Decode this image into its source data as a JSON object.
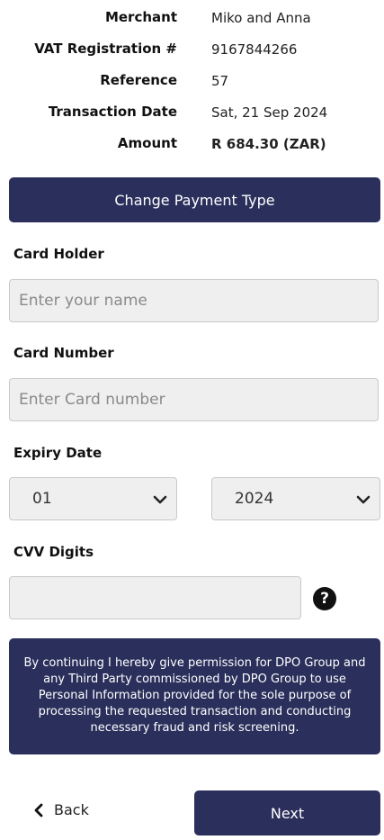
{
  "summary": {
    "merchant_label": "Merchant",
    "merchant_value": "Miko and Anna",
    "vat_label": "VAT Registration #",
    "vat_value": "9167844266",
    "reference_label": "Reference",
    "reference_value": "57",
    "date_label": "Transaction Date",
    "date_value": "Sat, 21 Sep 2024",
    "amount_label": "Amount",
    "amount_value": "R 684.30 (ZAR)"
  },
  "change_payment_label": "Change Payment Type",
  "card_holder": {
    "label": "Card Holder",
    "placeholder": "Enter your name"
  },
  "card_number": {
    "label": "Card Number",
    "placeholder": "Enter Card number"
  },
  "expiry": {
    "label": "Expiry Date",
    "month": "01",
    "year": "2024"
  },
  "cvv": {
    "label": "CVV Digits",
    "help_glyph": "?"
  },
  "notice_text": "By continuing I hereby give permission for DPO Group and any Third Party commissioned by DPO Group to use Personal Information provided for the sole purpose of processing the requested transaction and conducting necessary fraud and risk screening.",
  "footer": {
    "back_label": "Back",
    "next_label": "Next"
  },
  "colors": {
    "primary": "#2a2f5b",
    "input_bg": "#efefef"
  },
  "icons": {
    "select_arrow": "chevron-down-icon",
    "back_arrow": "chevron-left-icon",
    "help": "question-circle-icon"
  }
}
